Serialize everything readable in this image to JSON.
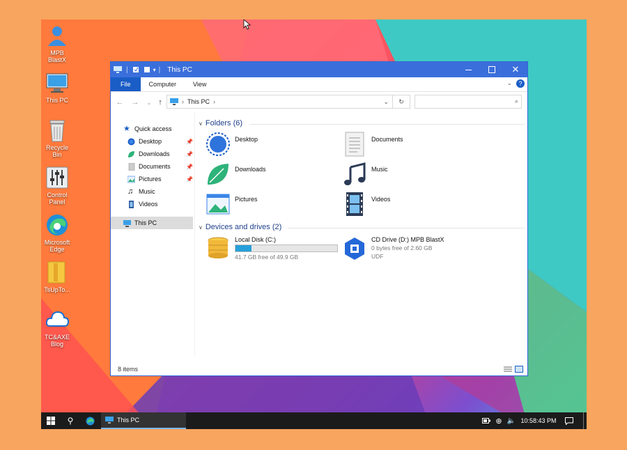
{
  "desktop": {
    "icons": [
      {
        "label": "MPB BlastX",
        "icon": "user-icon"
      },
      {
        "label": "This PC",
        "icon": "computer-icon"
      },
      {
        "label": "Recycle Bin",
        "icon": "recycle-bin-icon"
      },
      {
        "label": "Control Panel",
        "icon": "control-panel-icon"
      },
      {
        "label": "Microsoft Edge",
        "icon": "edge-icon"
      },
      {
        "label": "TsUpTo...",
        "icon": "folder-icon"
      },
      {
        "label": "TC&AXE Blog",
        "icon": "cloud-icon"
      }
    ]
  },
  "explorer": {
    "title": "This PC",
    "ribbon_tabs": [
      "File",
      "Computer",
      "View"
    ],
    "address": {
      "location": "This PC"
    },
    "search": {
      "placeholder": ""
    },
    "sidebar": {
      "quick_access": "Quick access",
      "items": [
        {
          "label": "Desktop",
          "pinned": true
        },
        {
          "label": "Downloads",
          "pinned": true
        },
        {
          "label": "Documents",
          "pinned": true
        },
        {
          "label": "Pictures",
          "pinned": true
        },
        {
          "label": "Music",
          "pinned": false
        },
        {
          "label": "Videos",
          "pinned": false
        }
      ],
      "this_pc": "This PC"
    },
    "folders_header": "Folders (6)",
    "folders": [
      "Desktop",
      "Documents",
      "Downloads",
      "Music",
      "Pictures",
      "Videos"
    ],
    "drives_header": "Devices and drives (2)",
    "drives": [
      {
        "name": "Local Disk (C:)",
        "free": "41.7 GB free of 49.9 GB",
        "used_fraction": 0.16
      },
      {
        "name": "CD Drive (D:) MPB BlastX",
        "free": "0 bytes free of 2.60 GB",
        "fs": "UDF"
      }
    ],
    "status": "8 items"
  },
  "taskbar": {
    "active_app": "This PC",
    "time": "10:58:43 PM"
  },
  "colors": {
    "titlebar": "#3a6fdb",
    "file_tab": "#1a5dc6",
    "accent": "#26a0da",
    "taskbar": "#1b1b1b"
  }
}
